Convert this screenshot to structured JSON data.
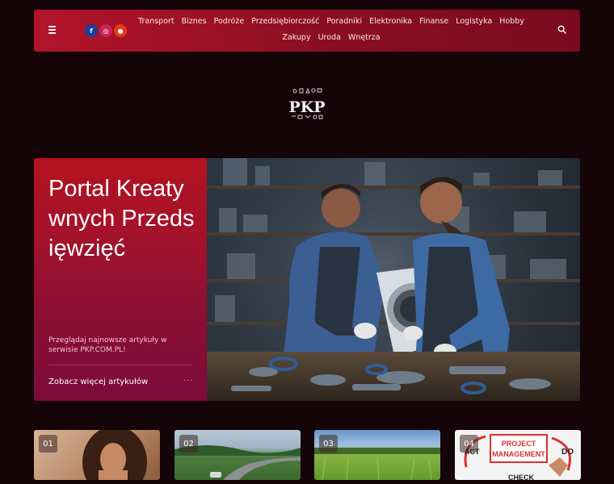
{
  "header": {
    "nav": [
      "Transport",
      "Biznes",
      "Podróże",
      "Przedsiębiorczość",
      "Poradniki",
      "Elektronika",
      "Finanse",
      "Logistyka",
      "Hobby",
      "Zakupy",
      "Uroda",
      "Wnętrza"
    ],
    "social": {
      "facebook": "f",
      "instagram": "◎",
      "reddit": "●"
    }
  },
  "logo": {
    "text": "PKP"
  },
  "hero": {
    "title": "Portal Kreatywnych Przedsięwzięć",
    "description": "Przeglądaj najnowsze artykuły w serwisie PKP.COM.PL!",
    "link": "Zobacz więcej artykułów",
    "dots": "···"
  },
  "cards": [
    {
      "num": "01"
    },
    {
      "num": "02"
    },
    {
      "num": "03"
    },
    {
      "num": "04",
      "sign_top": "PROJECT",
      "sign_bottom": "MANAGEMENT",
      "word_do": "DO",
      "word_act": "ACT",
      "word_check": "CHECK"
    }
  ],
  "colors": {
    "accent": "#b3142a",
    "background": "#150408"
  }
}
